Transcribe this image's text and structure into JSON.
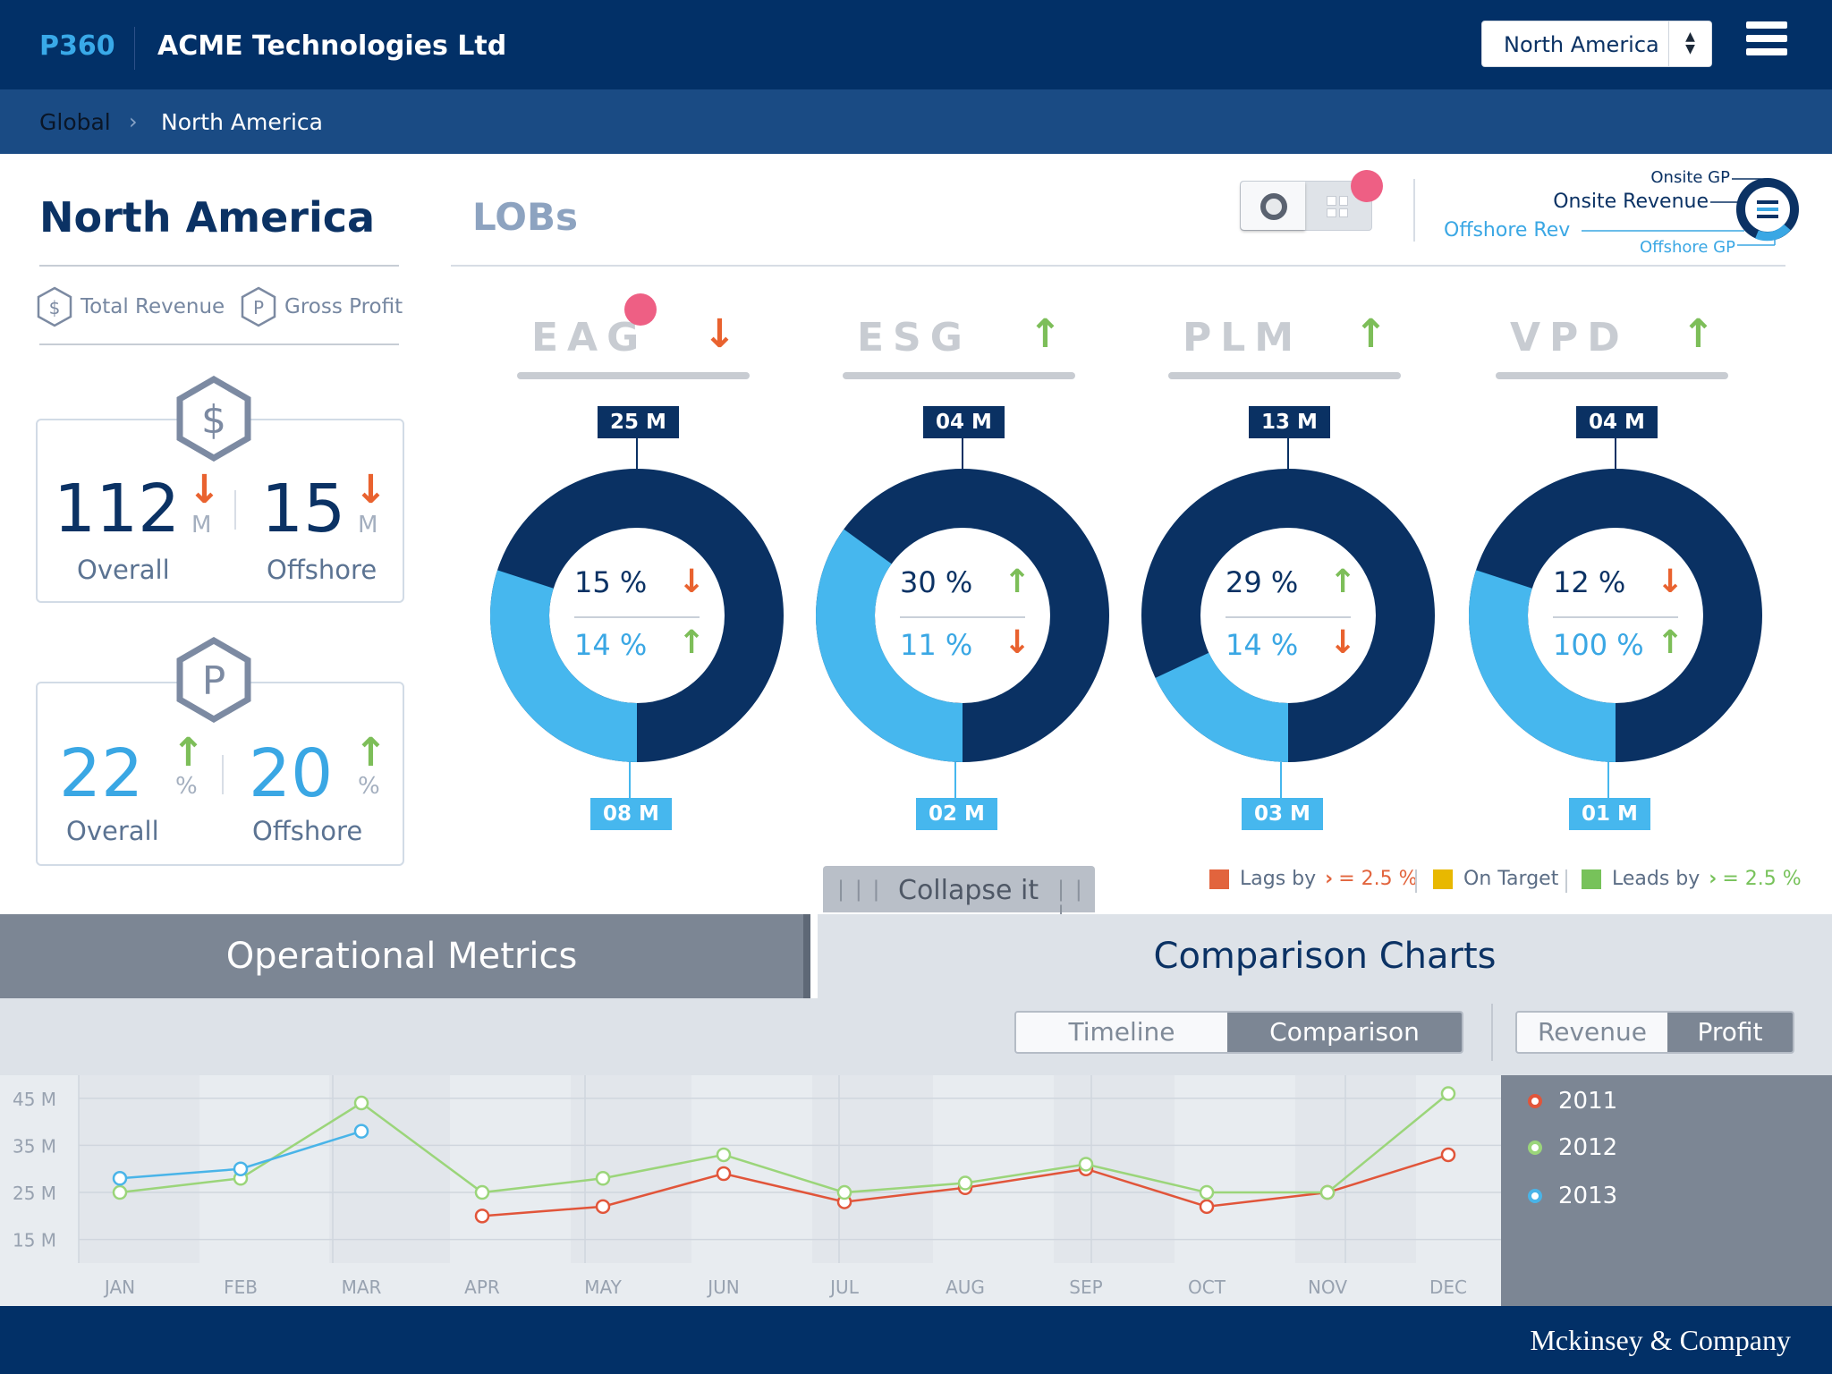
{
  "header": {
    "logo": "P360",
    "company": "ACME Technologies Ltd",
    "region_select": "North America"
  },
  "breadcrumb": {
    "root": "Global",
    "separator": "›",
    "current": "North America"
  },
  "left_panel": {
    "title": "North America",
    "legend": [
      {
        "icon": "dollar-hex-icon",
        "glyph": "$",
        "label": "Total Revenue"
      },
      {
        "icon": "p-hex-icon",
        "glyph": "P",
        "label": "Gross Profit"
      }
    ],
    "revenue_card": {
      "glyph": "$",
      "overall_value": "112",
      "overall_unit": "M",
      "overall_trend": "down",
      "offshore_value": "15",
      "offshore_unit": "M",
      "offshore_trend": "down",
      "overall_label": "Overall",
      "offshore_label": "Offshore"
    },
    "profit_card": {
      "glyph": "P",
      "overall_value": "22",
      "overall_unit": "%",
      "overall_trend": "up",
      "offshore_value": "20",
      "offshore_unit": "%",
      "offshore_trend": "up",
      "overall_label": "Overall",
      "offshore_label": "Offshore"
    }
  },
  "lob_section": {
    "title": "LOBs",
    "ring_legend": {
      "onsite_gp": "Onsite GP",
      "onsite_revenue": "Onsite Revenue",
      "offshore_rev": "Offshore Rev",
      "offshore_gp": "Offshore GP"
    },
    "lobs": [
      {
        "name": "EAG",
        "trend": "down",
        "top_tag": "25 M",
        "bottom_tag": "08 M",
        "light_share": 0.3,
        "pct_top": "15 %",
        "pct_top_trend": "down",
        "pct_bottom": "14 %",
        "pct_bottom_trend": "up"
      },
      {
        "name": "ESG",
        "trend": "up",
        "top_tag": "04 M",
        "bottom_tag": "02 M",
        "light_share": 0.35,
        "pct_top": "30 %",
        "pct_top_trend": "up",
        "pct_bottom": "11 %",
        "pct_bottom_trend": "down"
      },
      {
        "name": "PLM",
        "trend": "up",
        "top_tag": "13 M",
        "bottom_tag": "03 M",
        "light_share": 0.18,
        "pct_top": "29 %",
        "pct_top_trend": "up",
        "pct_bottom": "14 %",
        "pct_bottom_trend": "down"
      },
      {
        "name": "VPD",
        "trend": "up",
        "top_tag": "04 M",
        "bottom_tag": "01 M",
        "light_share": 0.3,
        "pct_top": "12 %",
        "pct_top_trend": "down",
        "pct_bottom": "100 %",
        "pct_bottom_trend": "up"
      }
    ],
    "collapse_label": "Collapse it",
    "color_legend": [
      {
        "label": "Lags by",
        "suffix": "= 2.5 %",
        "color": "#e2643d",
        "suffix_color": "#e2643d"
      },
      {
        "label": "On Target",
        "suffix": "",
        "color": "#e8b800",
        "suffix_color": ""
      },
      {
        "label": "Leads by",
        "suffix": "= 2.5 %",
        "color": "#77c25a",
        "suffix_color": "#77c25a"
      }
    ]
  },
  "bottom_tabs": {
    "operational": "Operational Metrics",
    "comparison": "Comparison Charts",
    "view_toggle": {
      "timeline": "Timeline",
      "comparison": "Comparison",
      "active": "Comparison"
    },
    "metric_toggle": {
      "revenue": "Revenue",
      "profit": "Profit",
      "active": "Profit"
    }
  },
  "chart_data": {
    "type": "line",
    "categories": [
      "JAN",
      "FEB",
      "MAR",
      "APR",
      "MAY",
      "JUN",
      "JUL",
      "AUG",
      "SEP",
      "OCT",
      "NOV",
      "DEC"
    ],
    "y_ticks": [
      "45 M",
      "35 M",
      "25 M",
      "15 M"
    ],
    "ylim": [
      10,
      48
    ],
    "grid": true,
    "legend_position": "right",
    "series": [
      {
        "name": "2011",
        "color": "#e1553a",
        "values": [
          null,
          null,
          null,
          20,
          22,
          29,
          23,
          26,
          30,
          22,
          25,
          33
        ]
      },
      {
        "name": "2012",
        "color": "#9bd57a",
        "values": [
          25,
          28,
          44,
          25,
          28,
          33,
          25,
          27,
          31,
          25,
          25,
          46
        ]
      },
      {
        "name": "2013",
        "color": "#49b4e8",
        "values": [
          28,
          30,
          38,
          null,
          null,
          null,
          null,
          null,
          null,
          null,
          null,
          null
        ]
      }
    ]
  },
  "footer": {
    "brand": "Mckinsey & Company"
  }
}
